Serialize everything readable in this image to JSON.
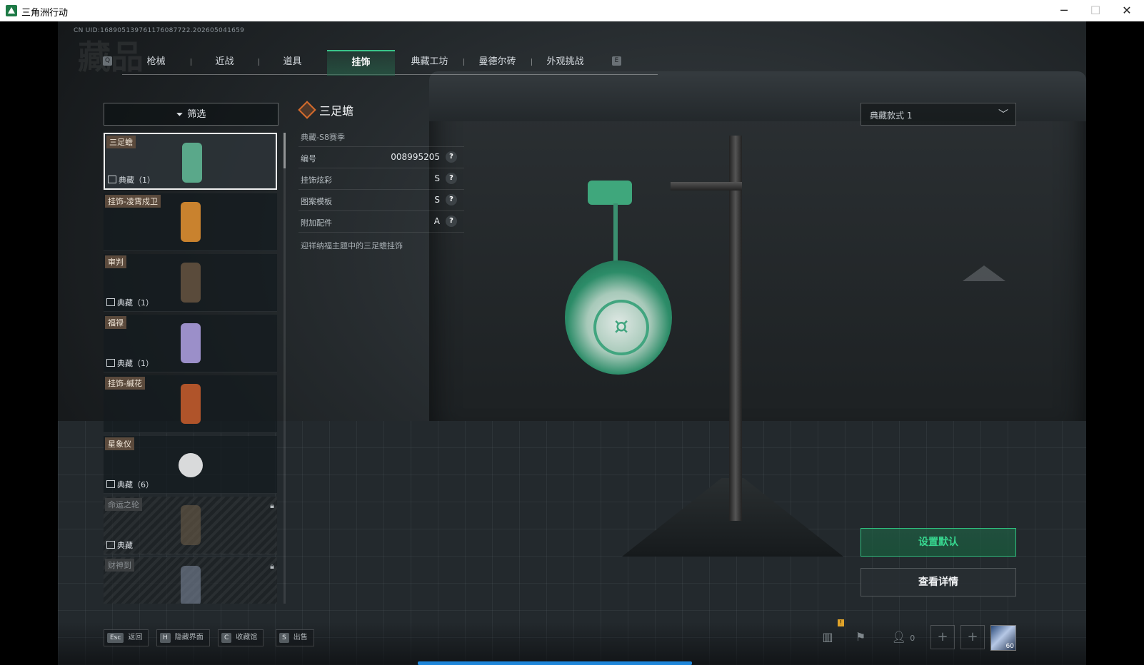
{
  "window": {
    "title": "三角洲行动",
    "minimize": "─",
    "maximize": "☐",
    "close": "✕"
  },
  "header": {
    "uid": "CN UID:168905139761176087722.202605041659",
    "bg_title": "藏品"
  },
  "tabs": {
    "prev_key": "Q",
    "next_key": "E",
    "items": [
      {
        "label": "枪械"
      },
      {
        "label": "近战"
      },
      {
        "label": "道具"
      },
      {
        "label": "挂饰",
        "active": true
      },
      {
        "label": "典藏工坊"
      },
      {
        "label": "曼德尔砖"
      },
      {
        "label": "外观挑战"
      }
    ]
  },
  "filter": {
    "label": "筛选",
    "icon": "filter-icon"
  },
  "items": [
    {
      "name": "三足蟾",
      "tag": "典藏（1）",
      "selected": true,
      "color": "#5aa88a"
    },
    {
      "name": "挂饰-凌霄戍卫",
      "tag": "",
      "color": "#c9822e"
    },
    {
      "name": "审判",
      "tag": "典藏（1）",
      "color": "#5a4b3b"
    },
    {
      "name": "福禄",
      "tag": "典藏（1）",
      "color": "#9b8fc9"
    },
    {
      "name": "挂饰-緘花",
      "tag": "",
      "color": "#b0542a"
    },
    {
      "name": "星象仪",
      "tag": "典藏（6）",
      "color": "#d9dadb"
    },
    {
      "name": "命运之轮",
      "tag": "典藏",
      "locked": true,
      "color": "#6b5c48"
    },
    {
      "name": "财神到",
      "tag": "",
      "locked": true,
      "color": "#7a8699"
    }
  ],
  "detail": {
    "title": "三足蟾",
    "subtitle": "典藏-S8赛季",
    "rows": [
      {
        "key": "编号",
        "value": "008995205"
      },
      {
        "key": "挂饰炫彩",
        "value": "S"
      },
      {
        "key": "图案模板",
        "value": "S"
      },
      {
        "key": "附加配件",
        "value": "A"
      }
    ],
    "help": "?",
    "description": "迎祥纳福主题中的三足蟾挂饰"
  },
  "style_select": {
    "value": "典藏款式 1",
    "icon": "chevron-down-icon"
  },
  "actions": {
    "set_default": "设置默认",
    "view_details": "查看详情"
  },
  "bottom": {
    "hotkeys": [
      {
        "key": "Esc",
        "label": "返回"
      },
      {
        "key": "H",
        "label": "隐藏界面"
      },
      {
        "key": "C",
        "label": "收藏馆"
      },
      {
        "key": "S",
        "label": "出售"
      }
    ],
    "friend_count": "0",
    "avatar_level": "60",
    "warn": "!",
    "plus": "+"
  },
  "colors": {
    "accent": "#2fc07f",
    "active_tab": "#3ac58a",
    "progress": "#1f86d9"
  }
}
